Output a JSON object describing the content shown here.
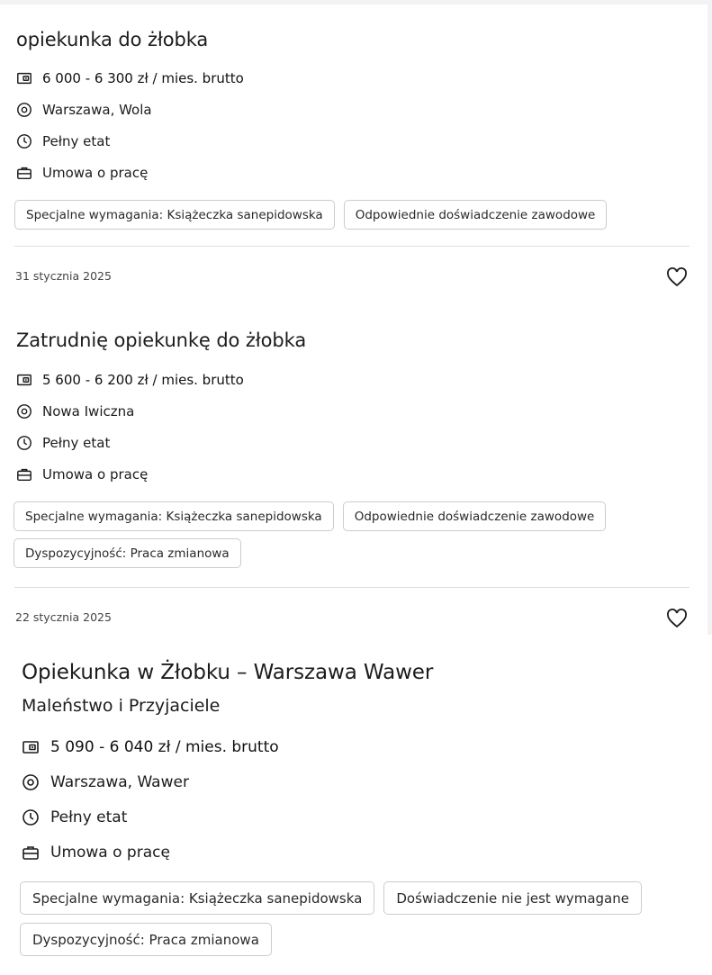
{
  "offers": [
    {
      "title": "opiekunka do żłobka",
      "salary": "6 000 - 6 300 zł / mies. brutto",
      "location": "Warszawa, Wola",
      "work_time": "Pełny etat",
      "contract": "Umowa o pracę",
      "tags": [
        "Specjalne wymagania: Książeczka sanepidowska",
        "Odpowiednie doświadczenie zawodowe"
      ],
      "date": "31 stycznia 2025"
    },
    {
      "title": "Zatrudnię opiekunkę do żłobka",
      "salary": "5 600 - 6 200 zł / mies. brutto",
      "location": "Nowa Iwiczna",
      "work_time": "Pełny etat",
      "contract": "Umowa o pracę",
      "tags": [
        "Specjalne wymagania: Książeczka sanepidowska",
        "Odpowiednie doświadczenie zawodowe",
        "Dyspozycyjność: Praca zmianowa"
      ],
      "date": "22 stycznia 2025"
    },
    {
      "title": "Opiekunka w Żłobku – Warszawa Wawer",
      "company": "Maleństwo i Przyjaciele",
      "salary": "5 090 - 6 040 zł / mies. brutto",
      "location": "Warszawa, Wawer",
      "work_time": "Pełny etat",
      "contract": "Umowa o pracę",
      "tags": [
        "Specjalne wymagania: Książeczka sanepidowska",
        "Doświadczenie nie jest wymagane",
        "Dyspozycyjność: Praca zmianowa"
      ]
    }
  ],
  "icons": {
    "salary": "wallet-icon",
    "location": "location-pin-icon",
    "work_time": "clock-icon",
    "contract": "briefcase-icon",
    "favorite": "heart-icon"
  },
  "colors": {
    "background": "#f2f3f5",
    "card": "#ffffff",
    "text": "#1c1c1c",
    "tag_border": "#c9ccd2",
    "divider": "#dcdfe4"
  }
}
